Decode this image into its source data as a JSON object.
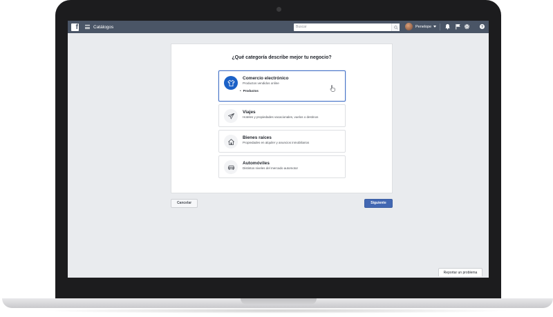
{
  "topbar": {
    "logo_letter": "f",
    "app_title": "Catálogos",
    "search_placeholder": "Buscar",
    "profile_name": "Penelope"
  },
  "card": {
    "question": "¿Qué categoría describe mejor tu negocio?",
    "options": [
      {
        "title": "Comercio electrónico",
        "description": "Productos vendidos online",
        "bullet": "Productos",
        "icon": "shirt-icon",
        "selected": true
      },
      {
        "title": "Viajes",
        "description": "Hoteles y propiedades vacacionales, vuelos o destinos",
        "icon": "plane-icon",
        "selected": false
      },
      {
        "title": "Bienes raíces",
        "description": "Propiedades en alquiler y anuncios inmobiliarios",
        "icon": "house-icon",
        "selected": false
      },
      {
        "title": "Automóviles",
        "description": "Distintos niveles del mercado automotor",
        "icon": "car-icon",
        "selected": false
      }
    ]
  },
  "footer": {
    "cancel_label": "Cancelar",
    "next_label": "Siguiente"
  },
  "report_label": "Reportar un problema",
  "colors": {
    "nav_bg": "#4a5566",
    "primary": "#4267b2",
    "selected_icon": "#1b61c7",
    "screen_bg": "#e9ebee"
  }
}
